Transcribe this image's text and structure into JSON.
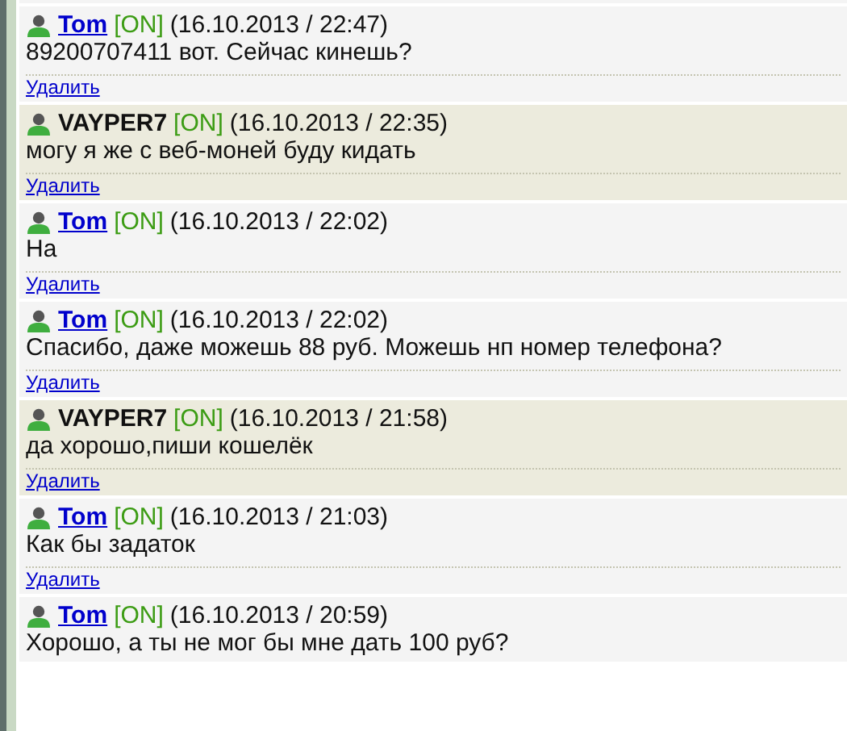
{
  "posts": [
    {
      "author": "Tom",
      "kind": "linked",
      "status": "[ON]",
      "date": "(16.10.2013 / 22:47)",
      "text": "89200707411 вот. Сейчас кинешь?",
      "delete": "Удалить"
    },
    {
      "author": "VAYPER7",
      "kind": "plain",
      "status": "[ON]",
      "date": "(16.10.2013 / 22:35)",
      "text": "могу я же с веб-моней буду кидать",
      "delete": "Удалить"
    },
    {
      "author": "Tom",
      "kind": "linked",
      "status": "[ON]",
      "date": "(16.10.2013 / 22:02)",
      "text": "На",
      "delete": "Удалить"
    },
    {
      "author": "Tom",
      "kind": "linked",
      "status": "[ON]",
      "date": "(16.10.2013 / 22:02)",
      "text": "Спасибо, даже можешь 88 руб. Можешь нп номер телефона?",
      "delete": "Удалить"
    },
    {
      "author": "VAYPER7",
      "kind": "plain",
      "status": "[ON]",
      "date": "(16.10.2013 / 21:58)",
      "text": "да хорошо,пиши кошелёк",
      "delete": "Удалить"
    },
    {
      "author": "Tom",
      "kind": "linked",
      "status": "[ON]",
      "date": "(16.10.2013 / 21:03)",
      "text": "Как бы задаток",
      "delete": "Удалить"
    },
    {
      "author": "Tom",
      "kind": "linked",
      "status": "[ON]",
      "date": "(16.10.2013 / 20:59)",
      "text": "Хорошо, а ты не мог бы мне дать 100 руб?"
    }
  ]
}
